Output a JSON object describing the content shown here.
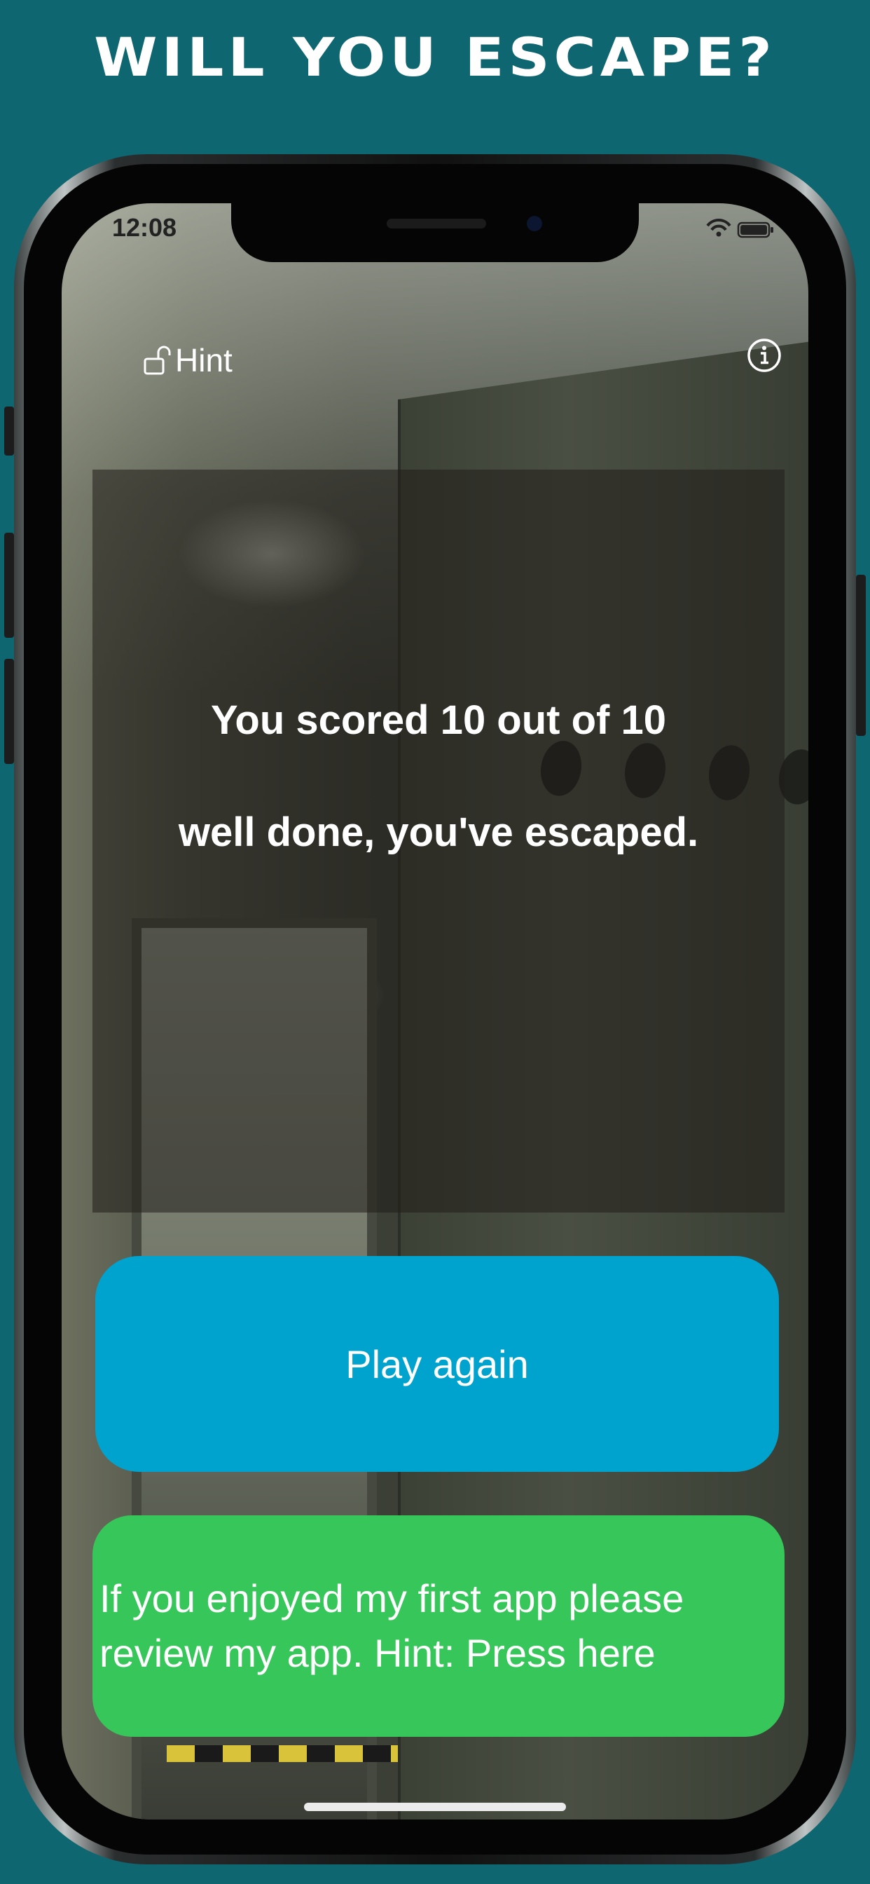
{
  "headline": "WILL YOU ESCAPE?",
  "status_bar": {
    "time": "12:08"
  },
  "nav": {
    "hint_label": "Hint",
    "hint_icon": "unlock-icon",
    "info_icon": "info-icon"
  },
  "result": {
    "score_text": "You scored 10 out of 10",
    "message_text": "well done, you've escaped."
  },
  "actions": {
    "play_again_label": "Play again",
    "review_label": "If you enjoyed my first app please review my app. Hint: Press here"
  },
  "colors": {
    "background": "#0e6670",
    "play_button": "#00a3cd",
    "review_button": "#37c65a",
    "overlay_panel": "#201e1a"
  }
}
